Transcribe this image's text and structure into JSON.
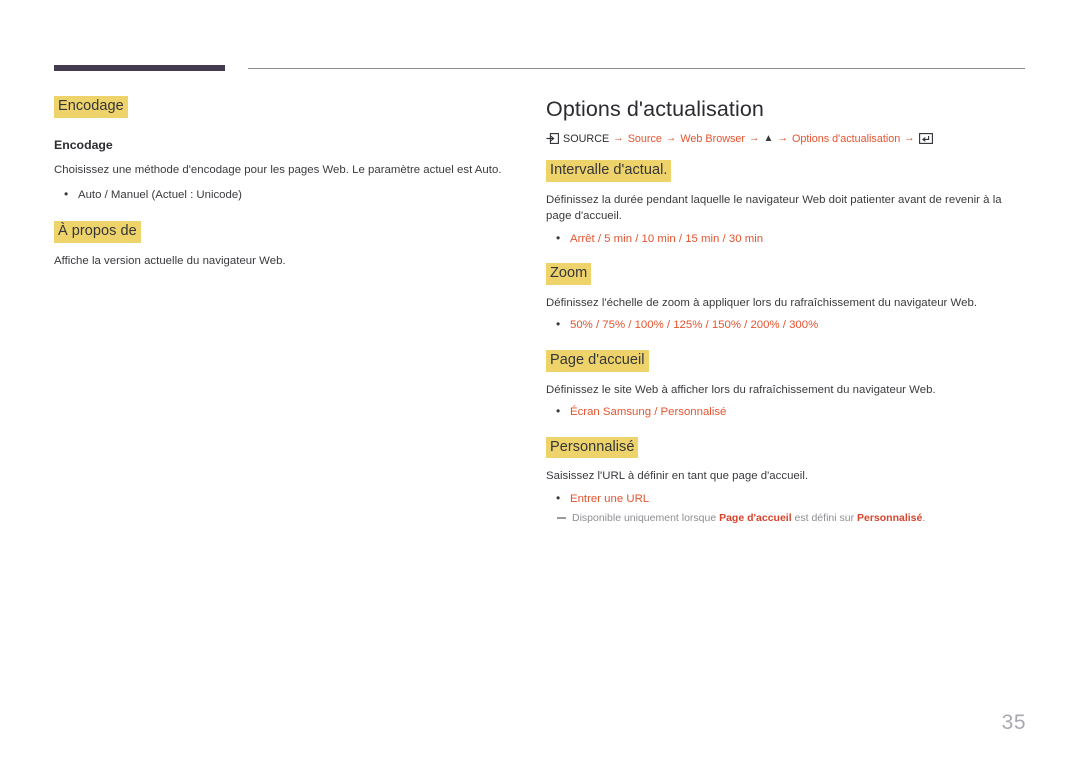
{
  "page": {
    "number": "35",
    "accent_highlight": "#edd36a",
    "accent_orange": "#e4542f",
    "rule_dark": "#433b4e",
    "rule_light": "#8c8c91"
  },
  "left_column": {
    "sections": [
      {
        "heading": "Encodage",
        "sub_heading": "Encodage",
        "body": "Choisissez une méthode d'encodage pour les pages Web. Le paramètre actuel est Auto.",
        "options": [
          "Auto / Manuel (Actuel : Unicode)"
        ],
        "option_style": "dark"
      },
      {
        "heading": "À propos de",
        "sub_heading": "",
        "body": "Affiche la version actuelle du navigateur Web.",
        "options": [],
        "option_style": "dark"
      }
    ]
  },
  "right_column": {
    "title": "Options d'actualisation",
    "breadcrumb": {
      "source_icon": "source-input-icon",
      "source_label": "SOURCE",
      "arrow": "→",
      "items": [
        {
          "label": "Source",
          "style": "orange"
        },
        {
          "label": "Web Browser",
          "style": "orange"
        },
        {
          "label": "▲",
          "style": "triangle"
        },
        {
          "label": "Options d'actualisation",
          "style": "orange"
        }
      ],
      "enter_icon": "enter-key-icon"
    },
    "sections": [
      {
        "heading": "Intervalle d'actual.",
        "body": "Définissez la durée pendant laquelle le navigateur Web doit patienter avant de revenir à la page d'accueil.",
        "options": [
          "Arrêt / 5 min / 10 min / 15 min / 30 min"
        ],
        "option_style": "orange",
        "note": null
      },
      {
        "heading": "Zoom",
        "body": "Définissez l'échelle de zoom à appliquer lors du rafraîchissement du navigateur Web.",
        "options": [
          "50% / 75% / 100% / 125% / 150% / 200% / 300%"
        ],
        "option_style": "orange",
        "note": null
      },
      {
        "heading": "Page d'accueil",
        "body": "Définissez le site Web à afficher lors du rafraîchissement du navigateur Web.",
        "options": [
          "Écran Samsung / Personnalisé"
        ],
        "option_style": "orange",
        "note": null
      },
      {
        "heading": "Personnalisé",
        "body": "Saisissez l'URL à définir en tant que page d'accueil.",
        "options": [
          "Entrer une URL"
        ],
        "option_style": "orange",
        "note": {
          "prefix": "Disponible uniquement lorsque ",
          "strong1": "Page d'accueil",
          "middle": " est défini sur ",
          "strong2": "Personnalisé",
          "suffix": "."
        }
      }
    ]
  }
}
